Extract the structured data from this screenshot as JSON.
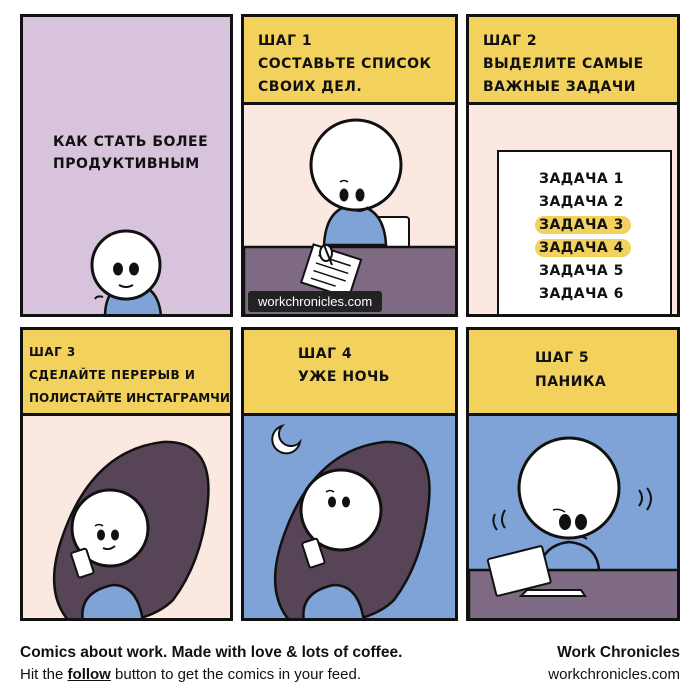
{
  "panels": {
    "p1": {
      "text_line1": "КАК СТАТЬ БОЛЕЕ",
      "text_line2": "ПРОДУКТИВНЫМ"
    },
    "p2": {
      "step": "ШАГ 1",
      "line1": "СОСТАВЬТЕ СПИСОК",
      "line2": "СВОИХ ДЕЛ.",
      "watermark": "workchronicles.com"
    },
    "p3": {
      "step": "ШАГ 2",
      "line1": "ВЫДЕЛИТЕ САМЫЕ",
      "line2": "ВАЖНЫЕ ЗАДАЧИ",
      "tasks": [
        "ЗАДАЧА 1",
        "ЗАДАЧА 2",
        "ЗАДАЧА 3",
        "ЗАДАЧА 4",
        "ЗАДАЧА 5",
        "ЗАДАЧА 6"
      ]
    },
    "p4": {
      "step": "ШАГ 3",
      "line1": "СДЕЛАЙТЕ ПЕРЕРЫВ И",
      "line2": "ПОЛИСТАЙТЕ ИНСТАГРАМЧИК"
    },
    "p5": {
      "step": "ШАГ 4",
      "line1": "УЖЕ НОЧЬ"
    },
    "p6": {
      "step": "ШАГ 5",
      "line1": "ПАНИКА"
    }
  },
  "footer": {
    "tagline": "Comics about work. Made with love & lots of coffee.",
    "hint_prefix": "Hit the ",
    "hint_follow": "follow",
    "hint_suffix": " button to get the comics in your feed.",
    "brand": "Work Chronicles",
    "site": "workchronicles.com"
  },
  "colors": {
    "caption": "#f2d15c",
    "panel1_bg": "#d7c3dc",
    "cream": "#fbe9e1",
    "night": "#7fa3d6",
    "desk": "#7e6a82",
    "highlight": "#f2d15c"
  }
}
